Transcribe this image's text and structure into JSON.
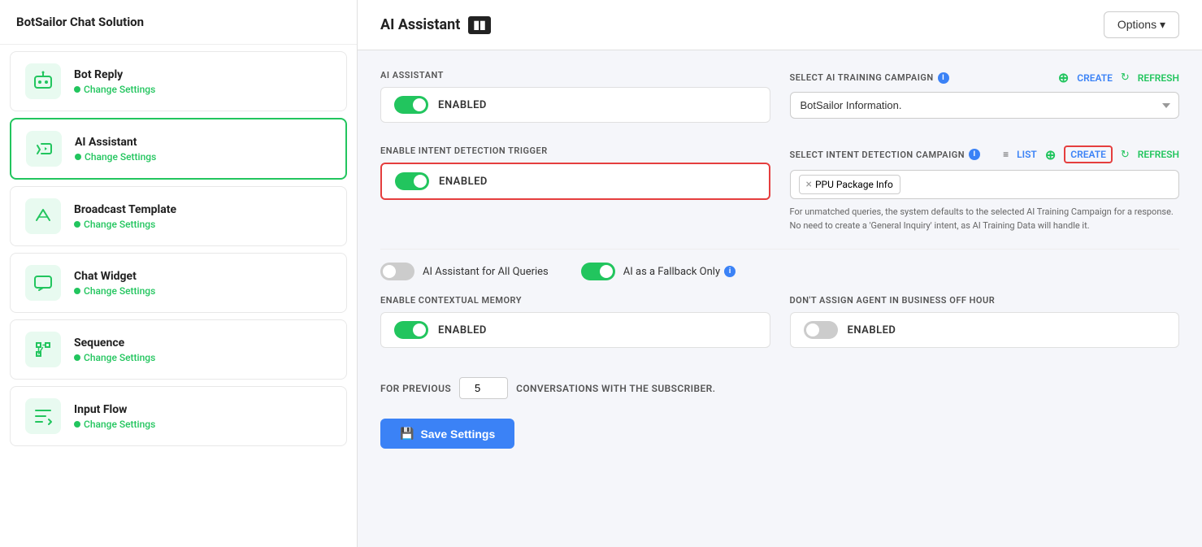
{
  "brand": "BotSailor Chat Solution",
  "sidebar": {
    "items": [
      {
        "id": "bot-reply",
        "name": "Bot Reply",
        "link": "Change Settings",
        "active": false
      },
      {
        "id": "ai-assistant",
        "name": "AI Assistant",
        "link": "Change Settings",
        "active": true
      },
      {
        "id": "broadcast-template",
        "name": "Broadcast Template",
        "link": "Change Settings",
        "active": false
      },
      {
        "id": "chat-widget",
        "name": "Chat Widget",
        "link": "Change Settings",
        "active": false
      },
      {
        "id": "sequence",
        "name": "Sequence",
        "link": "Change Settings",
        "active": false
      },
      {
        "id": "input-flow",
        "name": "Input Flow",
        "link": "Change Settings",
        "active": false
      }
    ]
  },
  "main": {
    "title": "AI Assistant",
    "options_label": "Options ▾",
    "sections": {
      "ai_assistant_label": "AI Assistant",
      "ai_assistant_toggle": "ENABLED",
      "intent_trigger_label": "ENABLE INTENT DETECTION TRIGGER",
      "intent_trigger_toggle": "ENABLED",
      "select_ai_label": "SELECT AI TRAINING CAMPAIGN",
      "select_ai_value": "BotSailor Information.",
      "create_label": "CREATE",
      "refresh_label": "REFRESH",
      "list_label": "LIST",
      "select_intent_label": "SELECT INTENT DETECTION CAMPAIGN",
      "intent_tag": "PPU Package Info",
      "intent_info": "For unmatched queries, the system defaults to the selected AI Training Campaign for a response. No need to create a 'General Inquiry' intent, as AI Training Data will handle it.",
      "ai_all_queries_label": "AI Assistant for All Queries",
      "ai_fallback_label": "AI as a Fallback Only",
      "contextual_memory_label": "ENABLE CONTEXTUAL MEMORY",
      "contextual_memory_toggle": "ENABLED",
      "dont_assign_label": "DON'T ASSIGN AGENT IN BUSINESS OFF HOUR",
      "dont_assign_toggle": "ENABLED",
      "for_previous_label": "FOR PREVIOUS",
      "for_previous_value": "5",
      "conversations_label": "CONVERSATIONS WITH THE SUBSCRIBER.",
      "save_label": "Save Settings"
    }
  }
}
